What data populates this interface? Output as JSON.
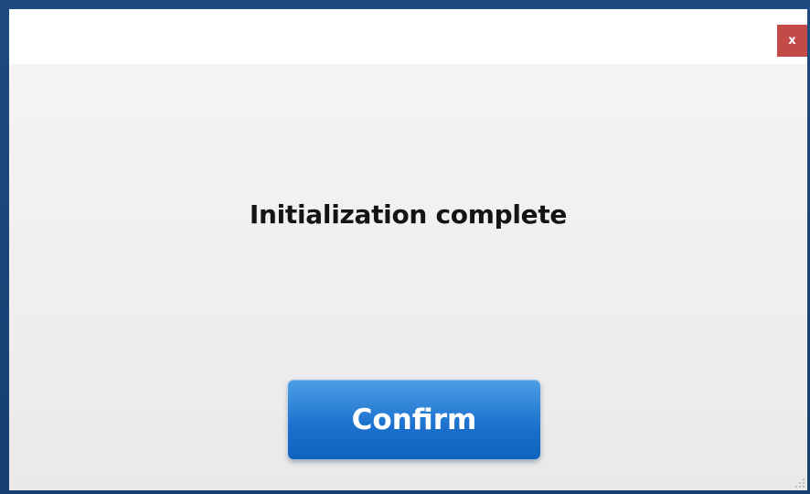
{
  "dialog": {
    "close_label": "x",
    "message": "Initialization complete",
    "confirm_label": "Confirm"
  },
  "icons": {
    "close": "close-icon",
    "resize": "resize-grip-icon"
  },
  "colors": {
    "frame": "#1d4a80",
    "close_button": "#c44a48",
    "confirm_button": "#1a70cc"
  }
}
